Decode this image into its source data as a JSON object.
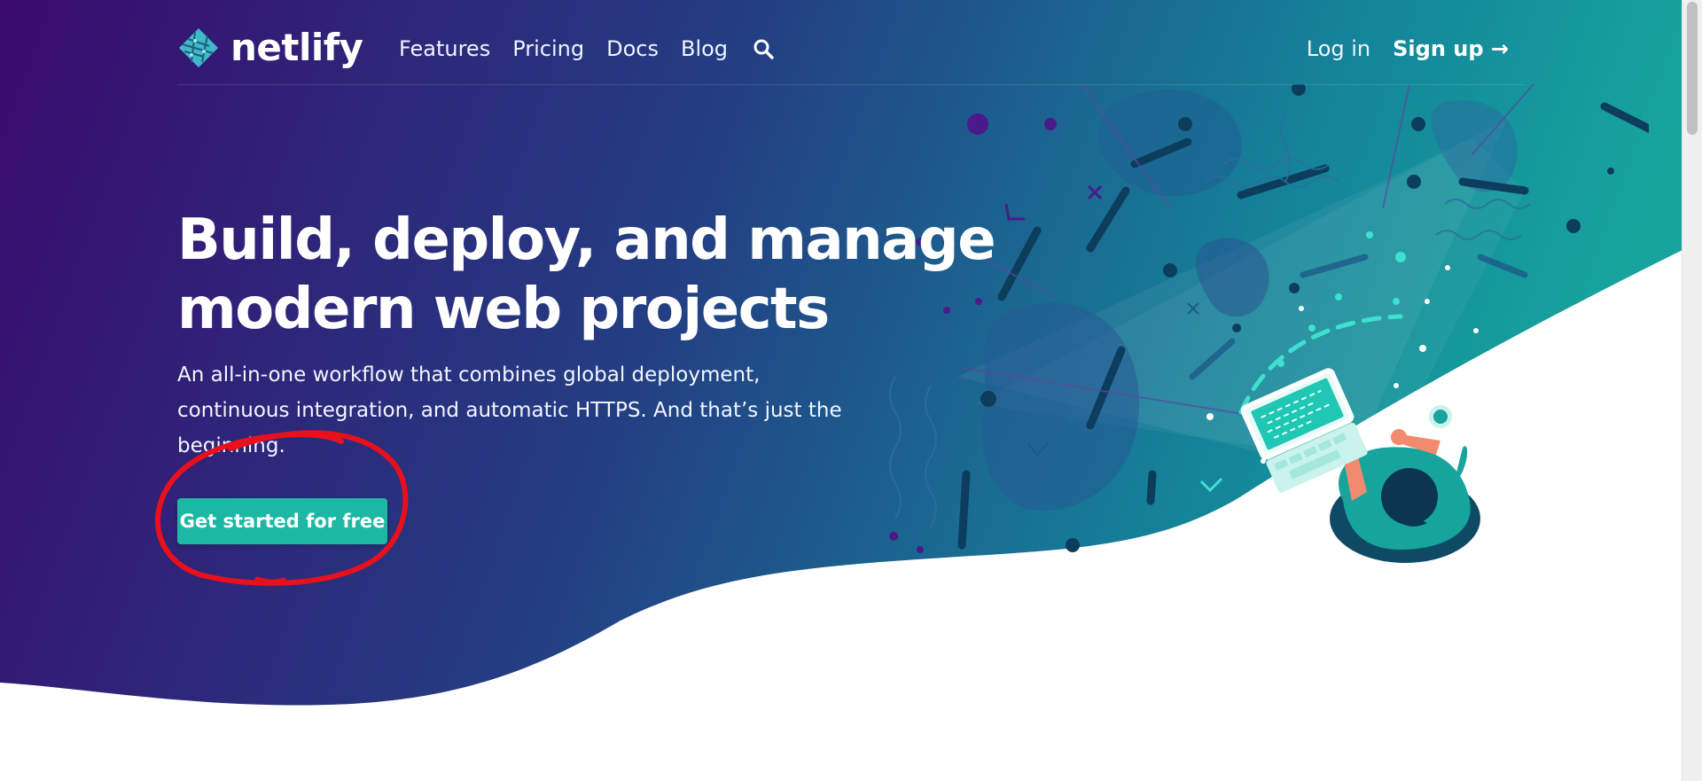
{
  "brand": {
    "name": "netlify",
    "colors": {
      "gradient_start": "#3a0a6e",
      "gradient_mid": "#233f83",
      "gradient_end": "#14a19a",
      "accent": "#1db8a4",
      "annotation": "#e8101c"
    }
  },
  "nav": {
    "links": [
      {
        "label": "Features"
      },
      {
        "label": "Pricing"
      },
      {
        "label": "Docs"
      },
      {
        "label": "Blog"
      }
    ],
    "search_icon": "search-icon",
    "login_label": "Log in",
    "signup_label": "Sign up →"
  },
  "hero": {
    "headline_line1": "Build, deploy, and manage",
    "headline_line2": "modern web projects",
    "subtitle": "An all-in-one workflow that combines global deployment, continuous integration, and automatic HTTPS. And that’s just the beginning.",
    "cta_label": "Get started for free",
    "illustration_icon": "developer-laptop-illustration"
  },
  "annotation": {
    "icon": "red-circle-highlight",
    "color": "#e8101c"
  }
}
